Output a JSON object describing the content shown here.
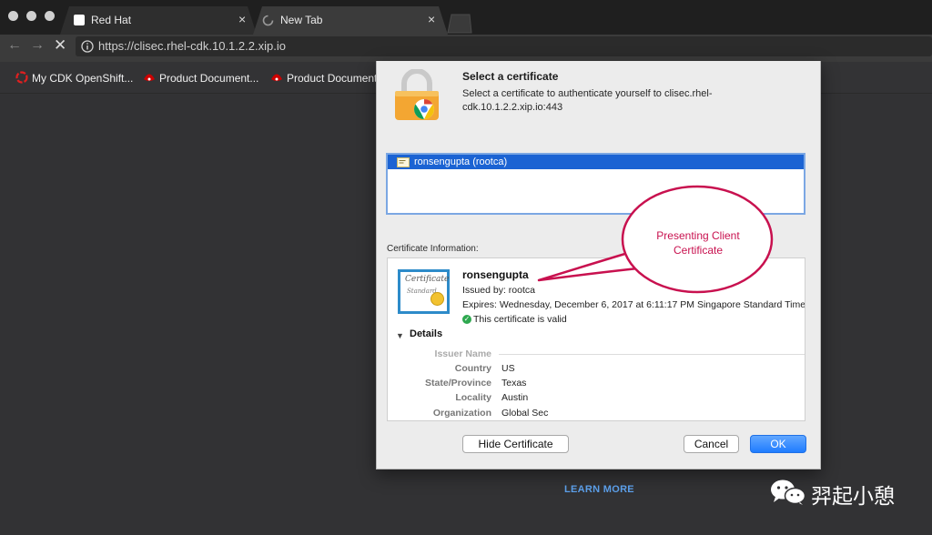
{
  "browser": {
    "tabs": [
      {
        "title": "Red Hat",
        "close": "×"
      },
      {
        "title": "New Tab",
        "close": "×"
      }
    ],
    "url": "https://clisec.rhel-cdk.10.1.2.2.xip.io",
    "bookmarks": [
      {
        "label": "My CDK OpenShift..."
      },
      {
        "label": "Product Document..."
      },
      {
        "label": "Product Document"
      }
    ]
  },
  "dialog": {
    "title": "Select a certificate",
    "description": "Select a certificate to authenticate yourself to clisec.rhel-cdk.10.1.2.2.xip.io:443",
    "certificate_item": "ronsengupta  (rootca)",
    "info_label": "Certificate Information:",
    "cert": {
      "name": "ronsengupta",
      "issued_by": "Issued by: rootca",
      "expires": "Expires: Wednesday, December 6, 2017 at 6:11:17 PM Singapore Standard Time",
      "valid_text": "This certificate is valid",
      "image_line1": "Certificate",
      "image_line2": "Standard"
    },
    "details_label": "Details",
    "details": {
      "issuer_name_label": "Issuer Name",
      "rows": [
        {
          "key": "Country",
          "value": "US"
        },
        {
          "key": "State/Province",
          "value": "Texas"
        },
        {
          "key": "Locality",
          "value": "Austin"
        },
        {
          "key": "Organization",
          "value": "Global Sec"
        }
      ]
    },
    "buttons": {
      "hide": "Hide Certificate",
      "cancel": "Cancel",
      "ok": "OK"
    }
  },
  "page": {
    "learn_more": "LEARN MORE"
  },
  "annotation": {
    "callout_line1": "Presenting Client",
    "callout_line2": "Certificate"
  },
  "watermark": {
    "text": "羿起小憩"
  },
  "colors": {
    "accent_blue": "#1b63d3",
    "callout": "#c8114f",
    "valid_green": "#2ea84f"
  }
}
